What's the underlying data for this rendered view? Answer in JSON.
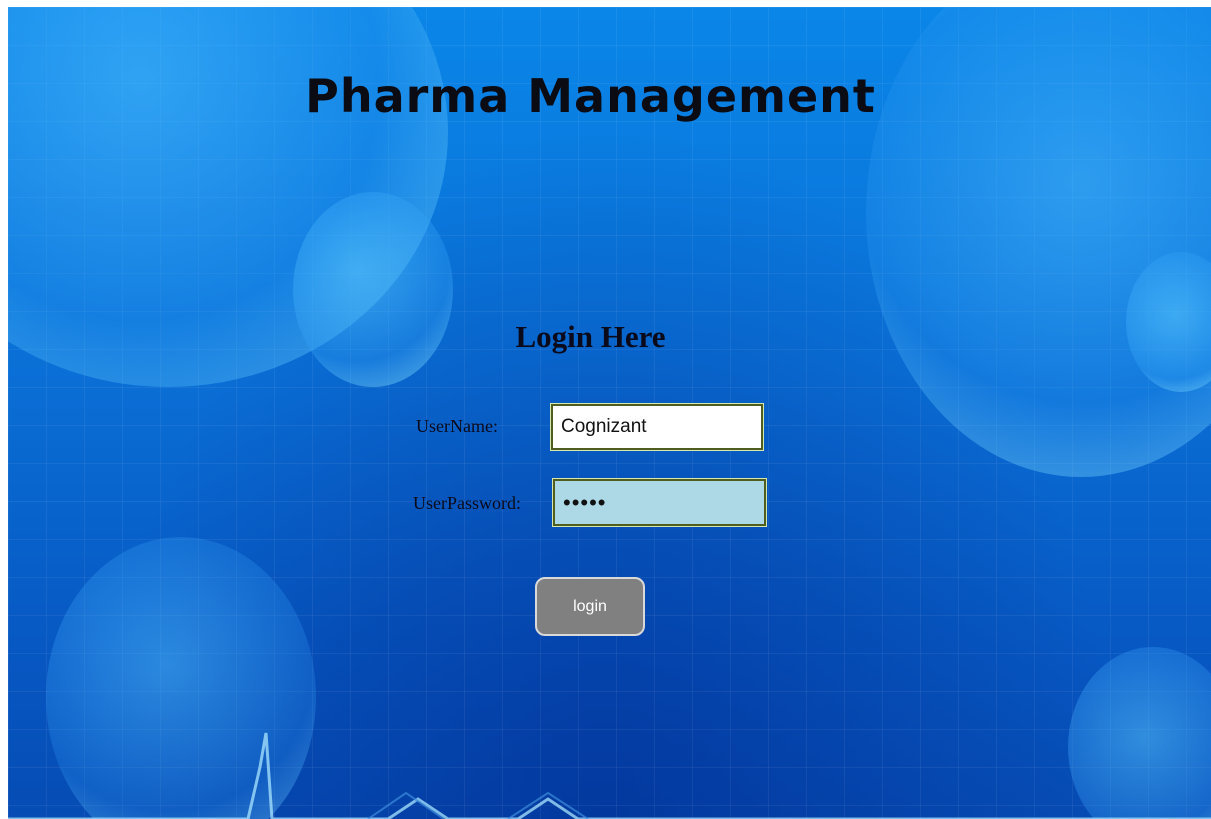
{
  "app": {
    "title": "Pharma Management"
  },
  "login_form": {
    "heading": "Login Here",
    "username_label": "UserName:",
    "username_value": "Cognizant",
    "password_label": "UserPassword:",
    "password_value": "•••••",
    "submit_label": "login"
  },
  "colors": {
    "background": "#0a6fd6",
    "password_field_bg": "#add8e6",
    "button_bg": "#808080"
  }
}
